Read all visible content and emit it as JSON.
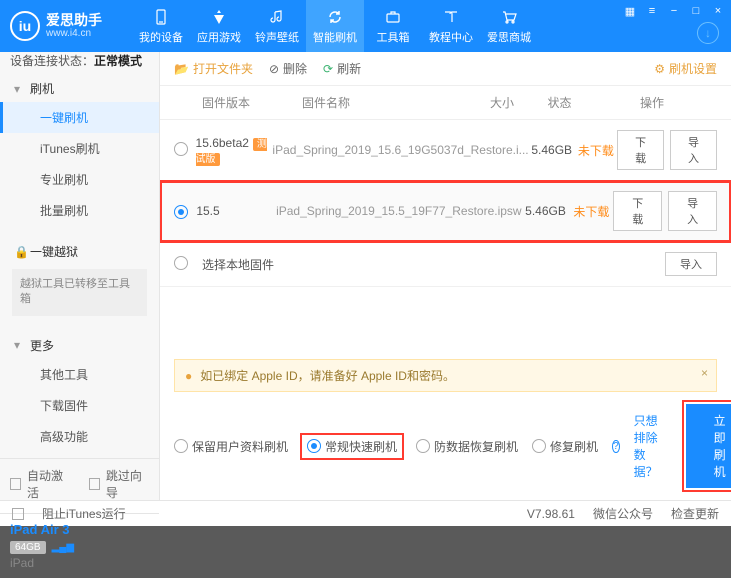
{
  "app": {
    "name": "爱思助手",
    "url": "www.i4.cn"
  },
  "nav": [
    {
      "label": "我的设备"
    },
    {
      "label": "应用游戏"
    },
    {
      "label": "铃声壁纸"
    },
    {
      "label": "智能刷机"
    },
    {
      "label": "工具箱"
    },
    {
      "label": "教程中心"
    },
    {
      "label": "爱思商城"
    }
  ],
  "connection": {
    "prefix": "设备连接状态：",
    "mode": "正常模式"
  },
  "sidebar": {
    "flash": {
      "title": "刷机",
      "items": [
        "一键刷机",
        "iTunes刷机",
        "专业刷机",
        "批量刷机"
      ]
    },
    "jailbreak": {
      "title": "一键越狱",
      "note": "越狱工具已转移至工具箱"
    },
    "more": {
      "title": "更多",
      "items": [
        "其他工具",
        "下载固件",
        "高级功能"
      ]
    },
    "footer": {
      "auto": "自动激活",
      "skip": "跳过向导"
    },
    "device": {
      "name": "iPad Air 3",
      "storage": "64GB",
      "type": "iPad"
    }
  },
  "toolbar": {
    "open": "打开文件夹",
    "delete": "删除",
    "refresh": "刷新",
    "settings": "刷机设置"
  },
  "table": {
    "headers": {
      "ver": "固件版本",
      "name": "固件名称",
      "size": "大小",
      "status": "状态",
      "ops": "操作"
    },
    "rows": [
      {
        "ver": "15.6beta2",
        "tag": "测试版",
        "name": "iPad_Spring_2019_15.6_19G5037d_Restore.i...",
        "size": "5.46GB",
        "status": "未下载",
        "dl": "下载",
        "imp": "导入"
      },
      {
        "ver": "15.5",
        "name": "iPad_Spring_2019_15.5_19F77_Restore.ipsw",
        "size": "5.46GB",
        "status": "未下载",
        "dl": "下载",
        "imp": "导入"
      }
    ],
    "local": {
      "label": "选择本地固件",
      "imp": "导入"
    }
  },
  "notice": {
    "text": "如已绑定 Apple ID，请准备好 Apple ID和密码。"
  },
  "options": {
    "keep": "保留用户资料刷机",
    "fast": "常规快速刷机",
    "recover": "防数据恢复刷机",
    "repair": "修复刷机",
    "exclude": "只想排除数据？",
    "flash": "立即刷机"
  },
  "statusbar": {
    "block": "阻止iTunes运行",
    "ver": "V7.98.61",
    "wechat": "微信公众号",
    "update": "检查更新"
  }
}
